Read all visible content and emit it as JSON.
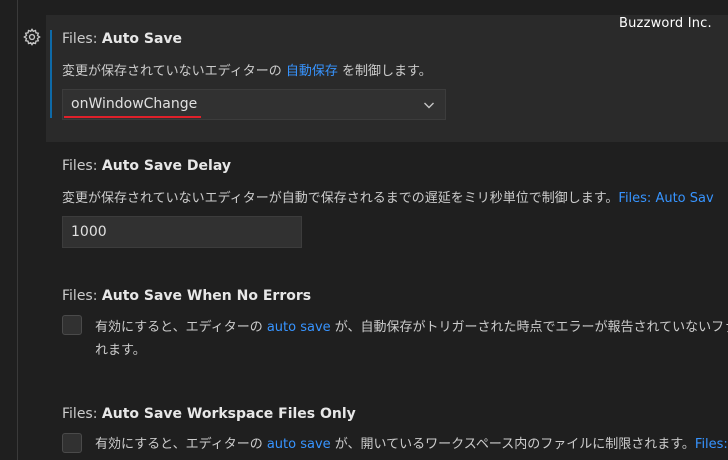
{
  "watermark": "Buzzword Inc.",
  "icons": {
    "gear": "gear-icon",
    "chevron": "chevron-down-icon"
  },
  "colors": {
    "link": "#3794ff",
    "focus_bar": "#0e6aa8",
    "underline": "#e0202a",
    "background": "#1f1f1f"
  },
  "settings": {
    "auto_save": {
      "category": "Files: ",
      "name": "Auto Save",
      "desc_before": "変更が保存されていないエディターの ",
      "desc_link": "自動保存",
      "desc_after": " を制御します。",
      "value": "onWindowChange"
    },
    "auto_save_delay": {
      "category": "Files: ",
      "name": "Auto Save Delay",
      "desc_before": "変更が保存されていないエディターが自動で保存されるまでの遅延をミリ秒単位で制御します。",
      "desc_link": "Files: Auto Sav",
      "value": "1000"
    },
    "auto_save_no_errors": {
      "category": "Files: ",
      "name": "Auto Save When No Errors",
      "line1_before": "有効にすると、エディターの ",
      "line1_link": "auto save",
      "line1_after": " が、自動保存がトリガーされた時点でエラーが報告されていないファイ",
      "line2": "れます。",
      "checked": false
    },
    "auto_save_workspace_only": {
      "category": "Files: ",
      "name": "Auto Save Workspace Files Only",
      "line1_before": "有効にすると、エディターの ",
      "line1_link": "auto save",
      "line1_after": " が、開いているワークスペース内のファイルに制限されます。",
      "line1_link2": "Files: Au",
      "checked": false
    }
  }
}
